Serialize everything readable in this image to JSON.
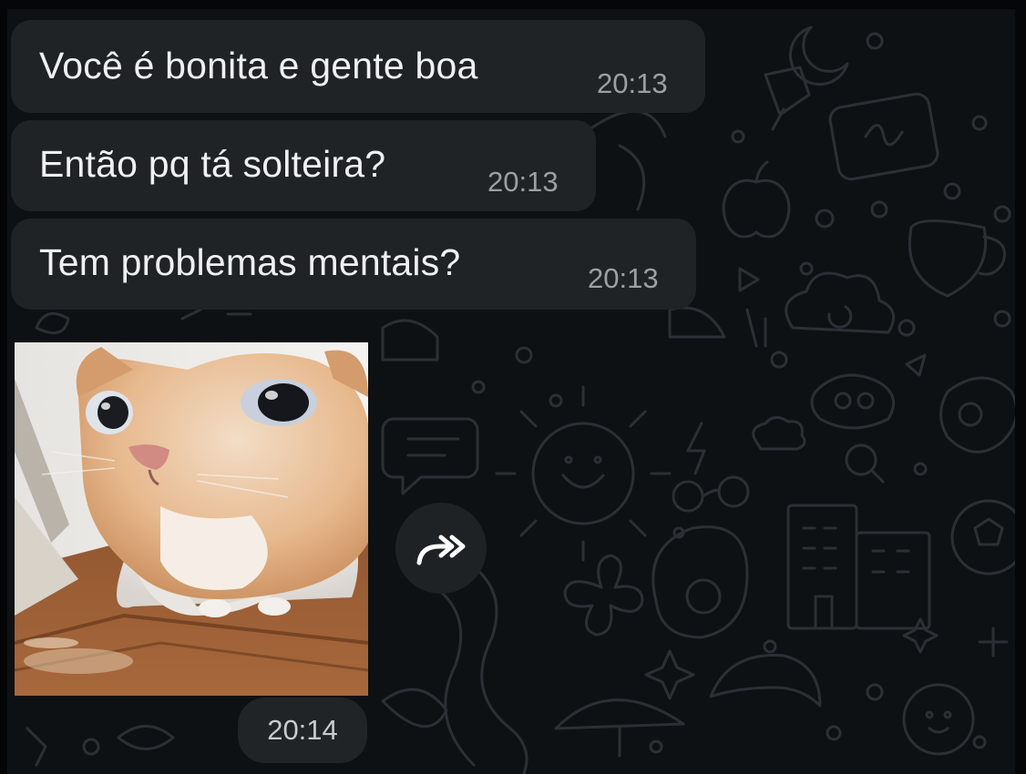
{
  "messages": [
    {
      "text": "Você é bonita e gente boa",
      "time": "20:13"
    },
    {
      "text": "Então pq tá solteira?",
      "time": "20:13"
    },
    {
      "text": "Tem problemas mentais?",
      "time": "20:13"
    }
  ],
  "media": {
    "time": "20:14",
    "forward_icon": "double-forward-arrow-icon"
  },
  "colors": {
    "background": "#0e1114",
    "bubble": "#1f2326",
    "text": "#eef0f1",
    "timestamp": "#9aa0a4",
    "doodle": "#2a3035"
  }
}
